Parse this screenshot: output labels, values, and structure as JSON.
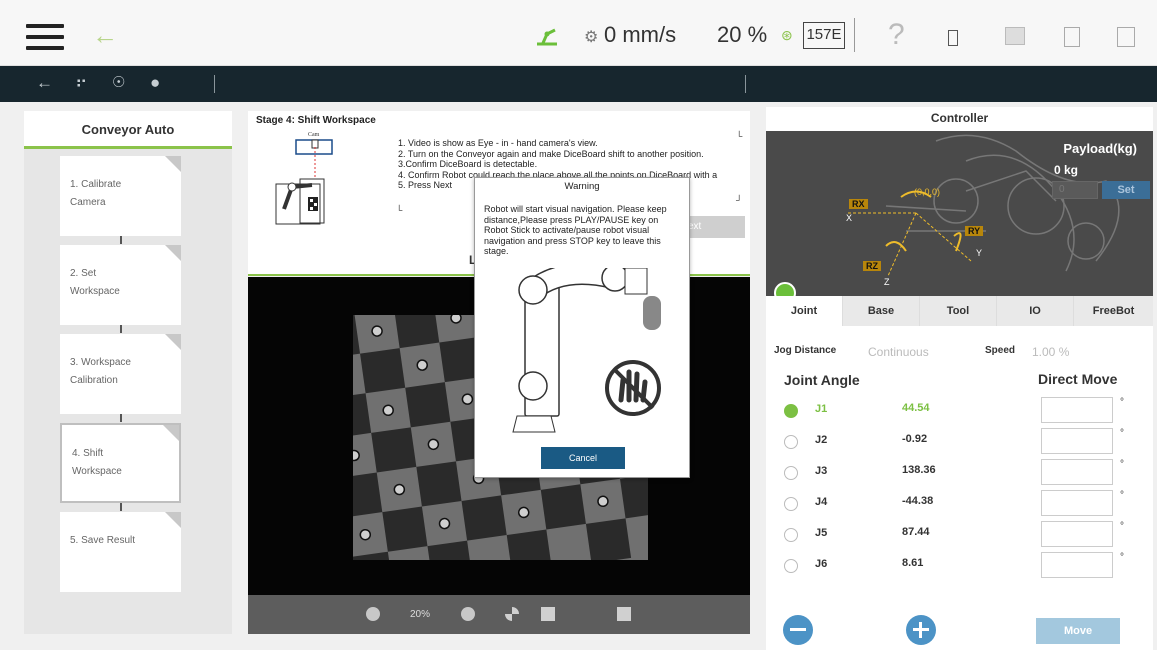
{
  "topbar": {
    "speed": "0 mm/s",
    "percent": "20 %",
    "code": "157E",
    "help": "?"
  },
  "left": {
    "title": "Conveyor Auto",
    "steps": [
      {
        "label": "1. Calibrate Camera"
      },
      {
        "label": "2. Set Workspace"
      },
      {
        "label": "3. Workspace Calibration"
      },
      {
        "label": "4. Shift Workspace",
        "active": true
      },
      {
        "label": "5. Save Result"
      }
    ]
  },
  "stage": {
    "title": "Stage 4: Shift Workspace",
    "instructions": "1. Video is show as Eye - in - hand camera's view.\n2. Turn on the Conveyor again and make DiceBoard shift to another position.\n3.Confirm DiceBoard is detectable.\n4. Confirm Robot could reach the place above all the points on DiceBoard with a\n5. Press Next",
    "fig_label": "Cam",
    "next_fragment": "ext",
    "l_letter": "L"
  },
  "video_controls": {
    "zoom": "20%"
  },
  "modal": {
    "title": "Warning",
    "message": "Robot will start visual navigation. Please keep distance,Please press PLAY/PAUSE key on Robot Stick to activate/pause robot visual navigation and press STOP key to leave this stage.",
    "cancel": "Cancel"
  },
  "controller": {
    "title": "Controller",
    "payload_label": "Payload(kg)",
    "payload_value": "0 kg",
    "payload_input": "0",
    "set": "Set",
    "origin": "(0,0,0)",
    "tags": {
      "rx": "RX",
      "ry": "RY",
      "rz": "RZ"
    },
    "axes": {
      "x": "X",
      "y": "Y",
      "z": "Z"
    },
    "tabs": [
      "Joint",
      "Base",
      "Tool",
      "IO",
      "FreeBot"
    ],
    "jog_distance_label": "Jog Distance",
    "jog_distance_value": "Continuous",
    "speed_label": "Speed",
    "speed_value": "1.00 %",
    "joint_angle_title": "Joint Angle",
    "direct_move_title": "Direct Move",
    "joints": [
      {
        "name": "J1",
        "value": "44.54",
        "selected": true
      },
      {
        "name": "J2",
        "value": "-0.92"
      },
      {
        "name": "J3",
        "value": "138.36"
      },
      {
        "name": "J4",
        "value": "-44.38"
      },
      {
        "name": "J5",
        "value": "87.44"
      },
      {
        "name": "J6",
        "value": "8.61"
      }
    ],
    "degree_symbol": "°",
    "move": "Move"
  },
  "colors": {
    "accent_green": "#8bc34a",
    "nav_dark": "#17262e",
    "button_blue": "#1a5a84",
    "circle_blue": "#4c93c6"
  }
}
